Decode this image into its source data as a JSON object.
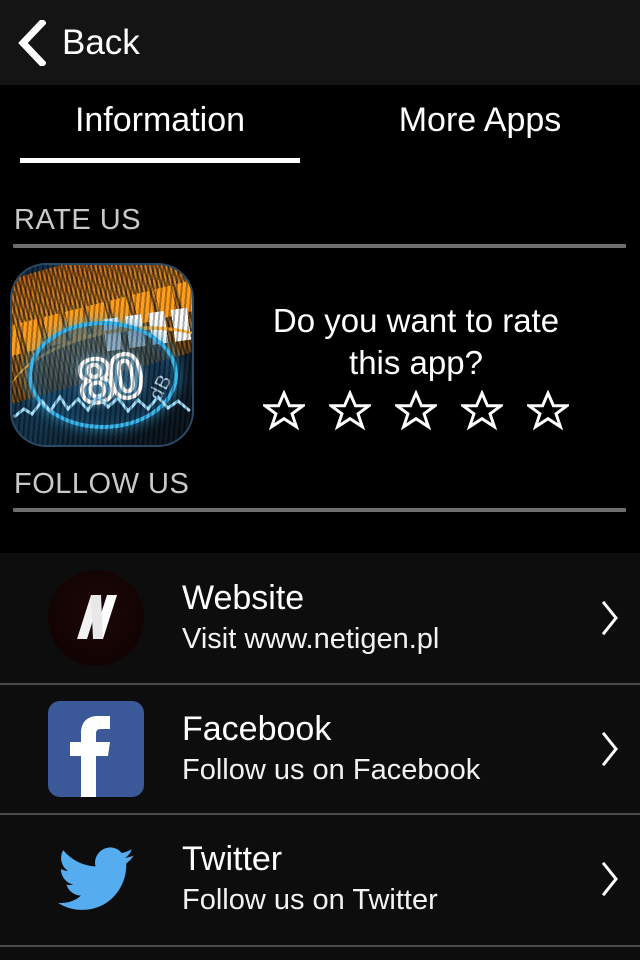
{
  "header": {
    "back_label": "Back",
    "back_icon": "chevron-left-icon",
    "background": "#141414"
  },
  "tabs": [
    {
      "label": "Information",
      "active": true
    },
    {
      "label": "More Apps",
      "active": false
    }
  ],
  "sections": [
    {
      "id": "rate-us",
      "title": "RATE US"
    },
    {
      "id": "follow-us",
      "title": "FOLLOW US"
    }
  ],
  "rate_us": {
    "app_icon": {
      "name": "sound-meter-app-icon",
      "value_text": "80",
      "unit_text": "dB"
    },
    "question": "Do you want to rate this app?",
    "stars": {
      "total": 5,
      "filled": 0,
      "glyph": "star-outline-icon"
    }
  },
  "follow_us": {
    "rows": [
      {
        "icon": "netigen-logo-icon",
        "title": "Website",
        "subtitle": "Visit www.netigen.pl",
        "chevron": "chevron-right-icon"
      },
      {
        "icon": "facebook-icon",
        "title": "Facebook",
        "subtitle": "Follow us on Facebook",
        "chevron": "chevron-right-icon"
      },
      {
        "icon": "twitter-icon",
        "title": "Twitter",
        "subtitle": "Follow us on Twitter",
        "chevron": "chevron-right-icon"
      }
    ]
  },
  "colors": {
    "background": "#000000",
    "header_bg": "#141414",
    "list_bg": "#0d0d0d",
    "section_title": "#c9c9c9",
    "rule": "#6e6e6e",
    "divider": "#4a4a4a",
    "facebook_blue": "#3b5998",
    "twitter_blue": "#55acee",
    "accent_white": "#ffffff"
  }
}
